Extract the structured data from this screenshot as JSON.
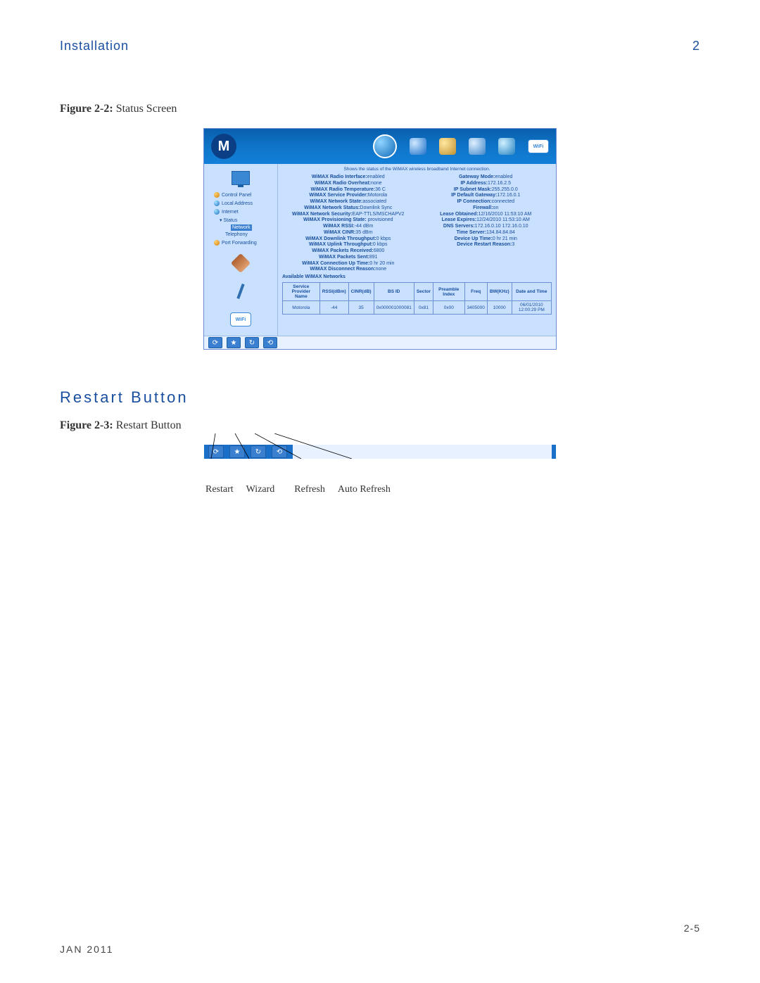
{
  "header": {
    "section": "Installation",
    "chapter_num": "2"
  },
  "figures": {
    "f22": {
      "label": "Figure 2-2:",
      "title": "Status Screen"
    },
    "f23": {
      "label": "Figure 2-3:",
      "title": "Restart Button"
    }
  },
  "section_title": "Restart Button",
  "footer": {
    "date": "JAN 2011",
    "page": "2-5"
  },
  "status_screen": {
    "description": "Shows the status of the WiMAX wireless broadband Internet connection.",
    "nav": {
      "control_panel": "Control Panel",
      "local_address": "Local Address",
      "internet": "Internet",
      "status": "Status",
      "network": "Network",
      "telephony": "Telephony",
      "port_forwarding": "Port Forwarding"
    },
    "wifi_label": "WiFi",
    "left_stats": [
      {
        "k": "WiMAX Radio Interface:",
        "v": "enabled"
      },
      {
        "k": "WiMAX Radio Overheat:",
        "v": "none"
      },
      {
        "k": "WiMAX Radio Temperature:",
        "v": "36 C"
      },
      {
        "k": "WiMAX Service Provider:",
        "v": "Motorola"
      },
      {
        "k": "WiMAX Network State:",
        "v": "associated"
      },
      {
        "k": "WiMAX Network Status:",
        "v": "Downlink Sync"
      },
      {
        "k": "WiMAX Network Security:",
        "v": "EAP-TTLS/MSCHAPV2"
      },
      {
        "k": "WiMAX Provisioning State:",
        "v": " provisioned"
      },
      {
        "k": "WiMAX RSSI:",
        "v": "-44 dBm"
      },
      {
        "k": "WiMAX CINR:",
        "v": "35 dBm"
      },
      {
        "k": "WiMAX Downlink Throughput:",
        "v": "0 kbps"
      },
      {
        "k": "WiMAX Uplink Throughput:",
        "v": "0 kbps"
      },
      {
        "k": "WiMAX Packets Received:",
        "v": "6800"
      },
      {
        "k": "WiMAX Packets Sent:",
        "v": "891"
      },
      {
        "k": "WiMAX Connection Up Time:",
        "v": "0 hr 20 min"
      },
      {
        "k": "WiMAX Disconnect Reason:",
        "v": "none"
      }
    ],
    "right_stats": [
      {
        "k": "Gateway Mode:",
        "v": "enabled"
      },
      {
        "k": "IP Address:",
        "v": "172.16.2.5"
      },
      {
        "k": "IP Subnet Mask:",
        "v": "255.255.0.0"
      },
      {
        "k": "IP Default Gateway:",
        "v": "172.16.0.1"
      },
      {
        "k": "IP Connection:",
        "v": "connected"
      },
      {
        "k": "Firewall:",
        "v": "on"
      },
      {
        "k": "Lease Obtained:",
        "v": "12/16/2010 11:53:10 AM"
      },
      {
        "k": "Lease Expires:",
        "v": "12/24/2010 11:53:10 AM"
      },
      {
        "k": "DNS Servers:",
        "v": "172.16.0.10 172.16.0.10"
      },
      {
        "k": "Time Server:",
        "v": "134.84.84.84"
      },
      {
        "k": "Device Up Time:",
        "v": "0 hr 21 min"
      },
      {
        "k": "Device Restart Reason:",
        "v": "3"
      }
    ],
    "avail_label": "Available WiMAX Networks",
    "table": {
      "headers": [
        "Service Provider Name",
        "RSSI(dBm)",
        "CINR(dB)",
        "BS ID",
        "Sector",
        "Preamble Index",
        "Freq",
        "BW(KHz)",
        "Date and Time"
      ],
      "row": [
        "Motorola",
        "-44",
        "35",
        "0x000001000081",
        "0x81",
        "0x00",
        "3405000",
        "10000",
        "06/01/2010 12:00:29 PM"
      ]
    }
  },
  "restart_fig": {
    "labels": [
      "Restart",
      "Wizard",
      "Refresh",
      "Auto Refresh"
    ]
  }
}
